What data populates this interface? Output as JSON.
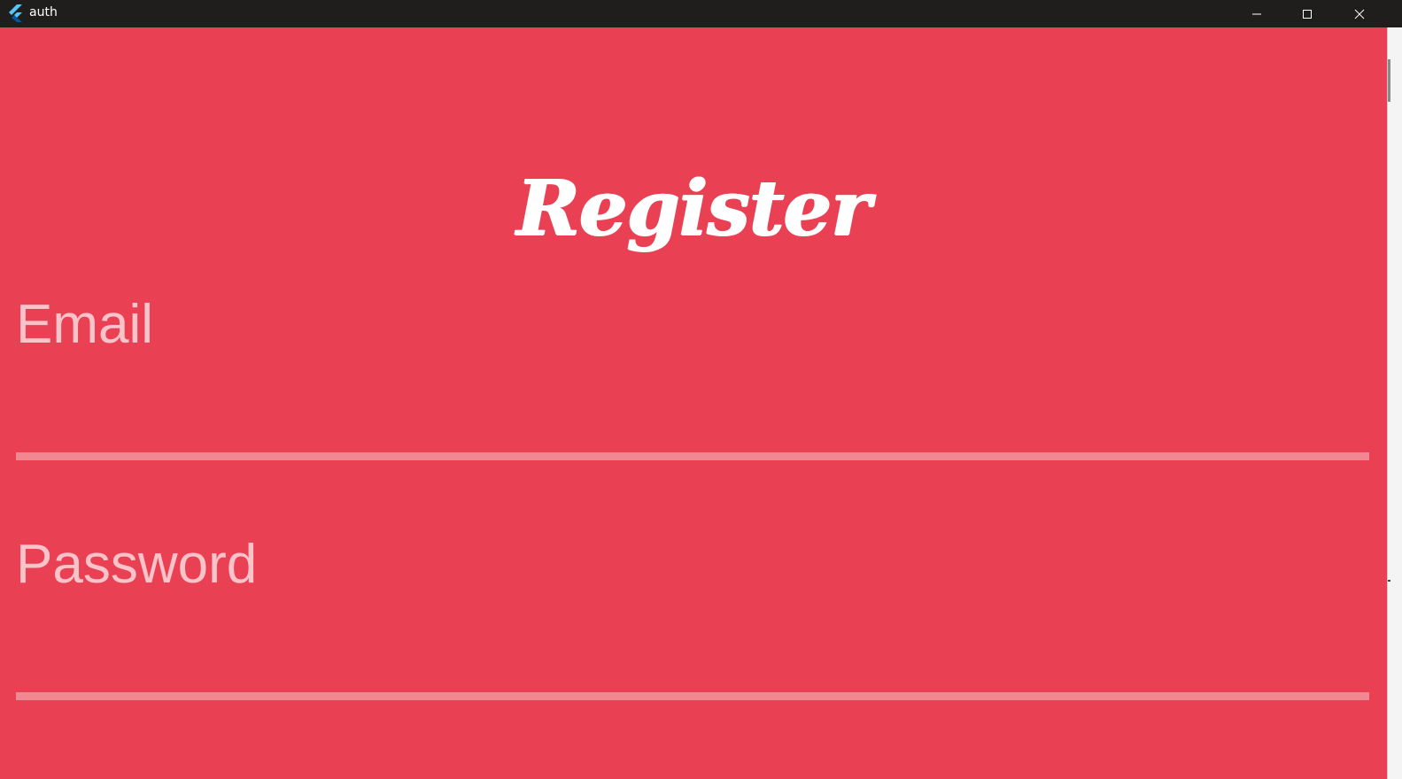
{
  "window": {
    "title": "auth",
    "icon": "flutter-logo",
    "controls": [
      "minimize-icon",
      "maximize-icon",
      "close-icon"
    ]
  },
  "colors": {
    "background": "#e94153",
    "titlebar": "#201e1d",
    "title_text": "#ffffff",
    "label_text": "#f9c3c9",
    "underline": "#f08791"
  },
  "main": {
    "title": "Register",
    "fields": [
      {
        "label": "Email",
        "value": ""
      },
      {
        "label": "Password",
        "value": ""
      }
    ]
  }
}
